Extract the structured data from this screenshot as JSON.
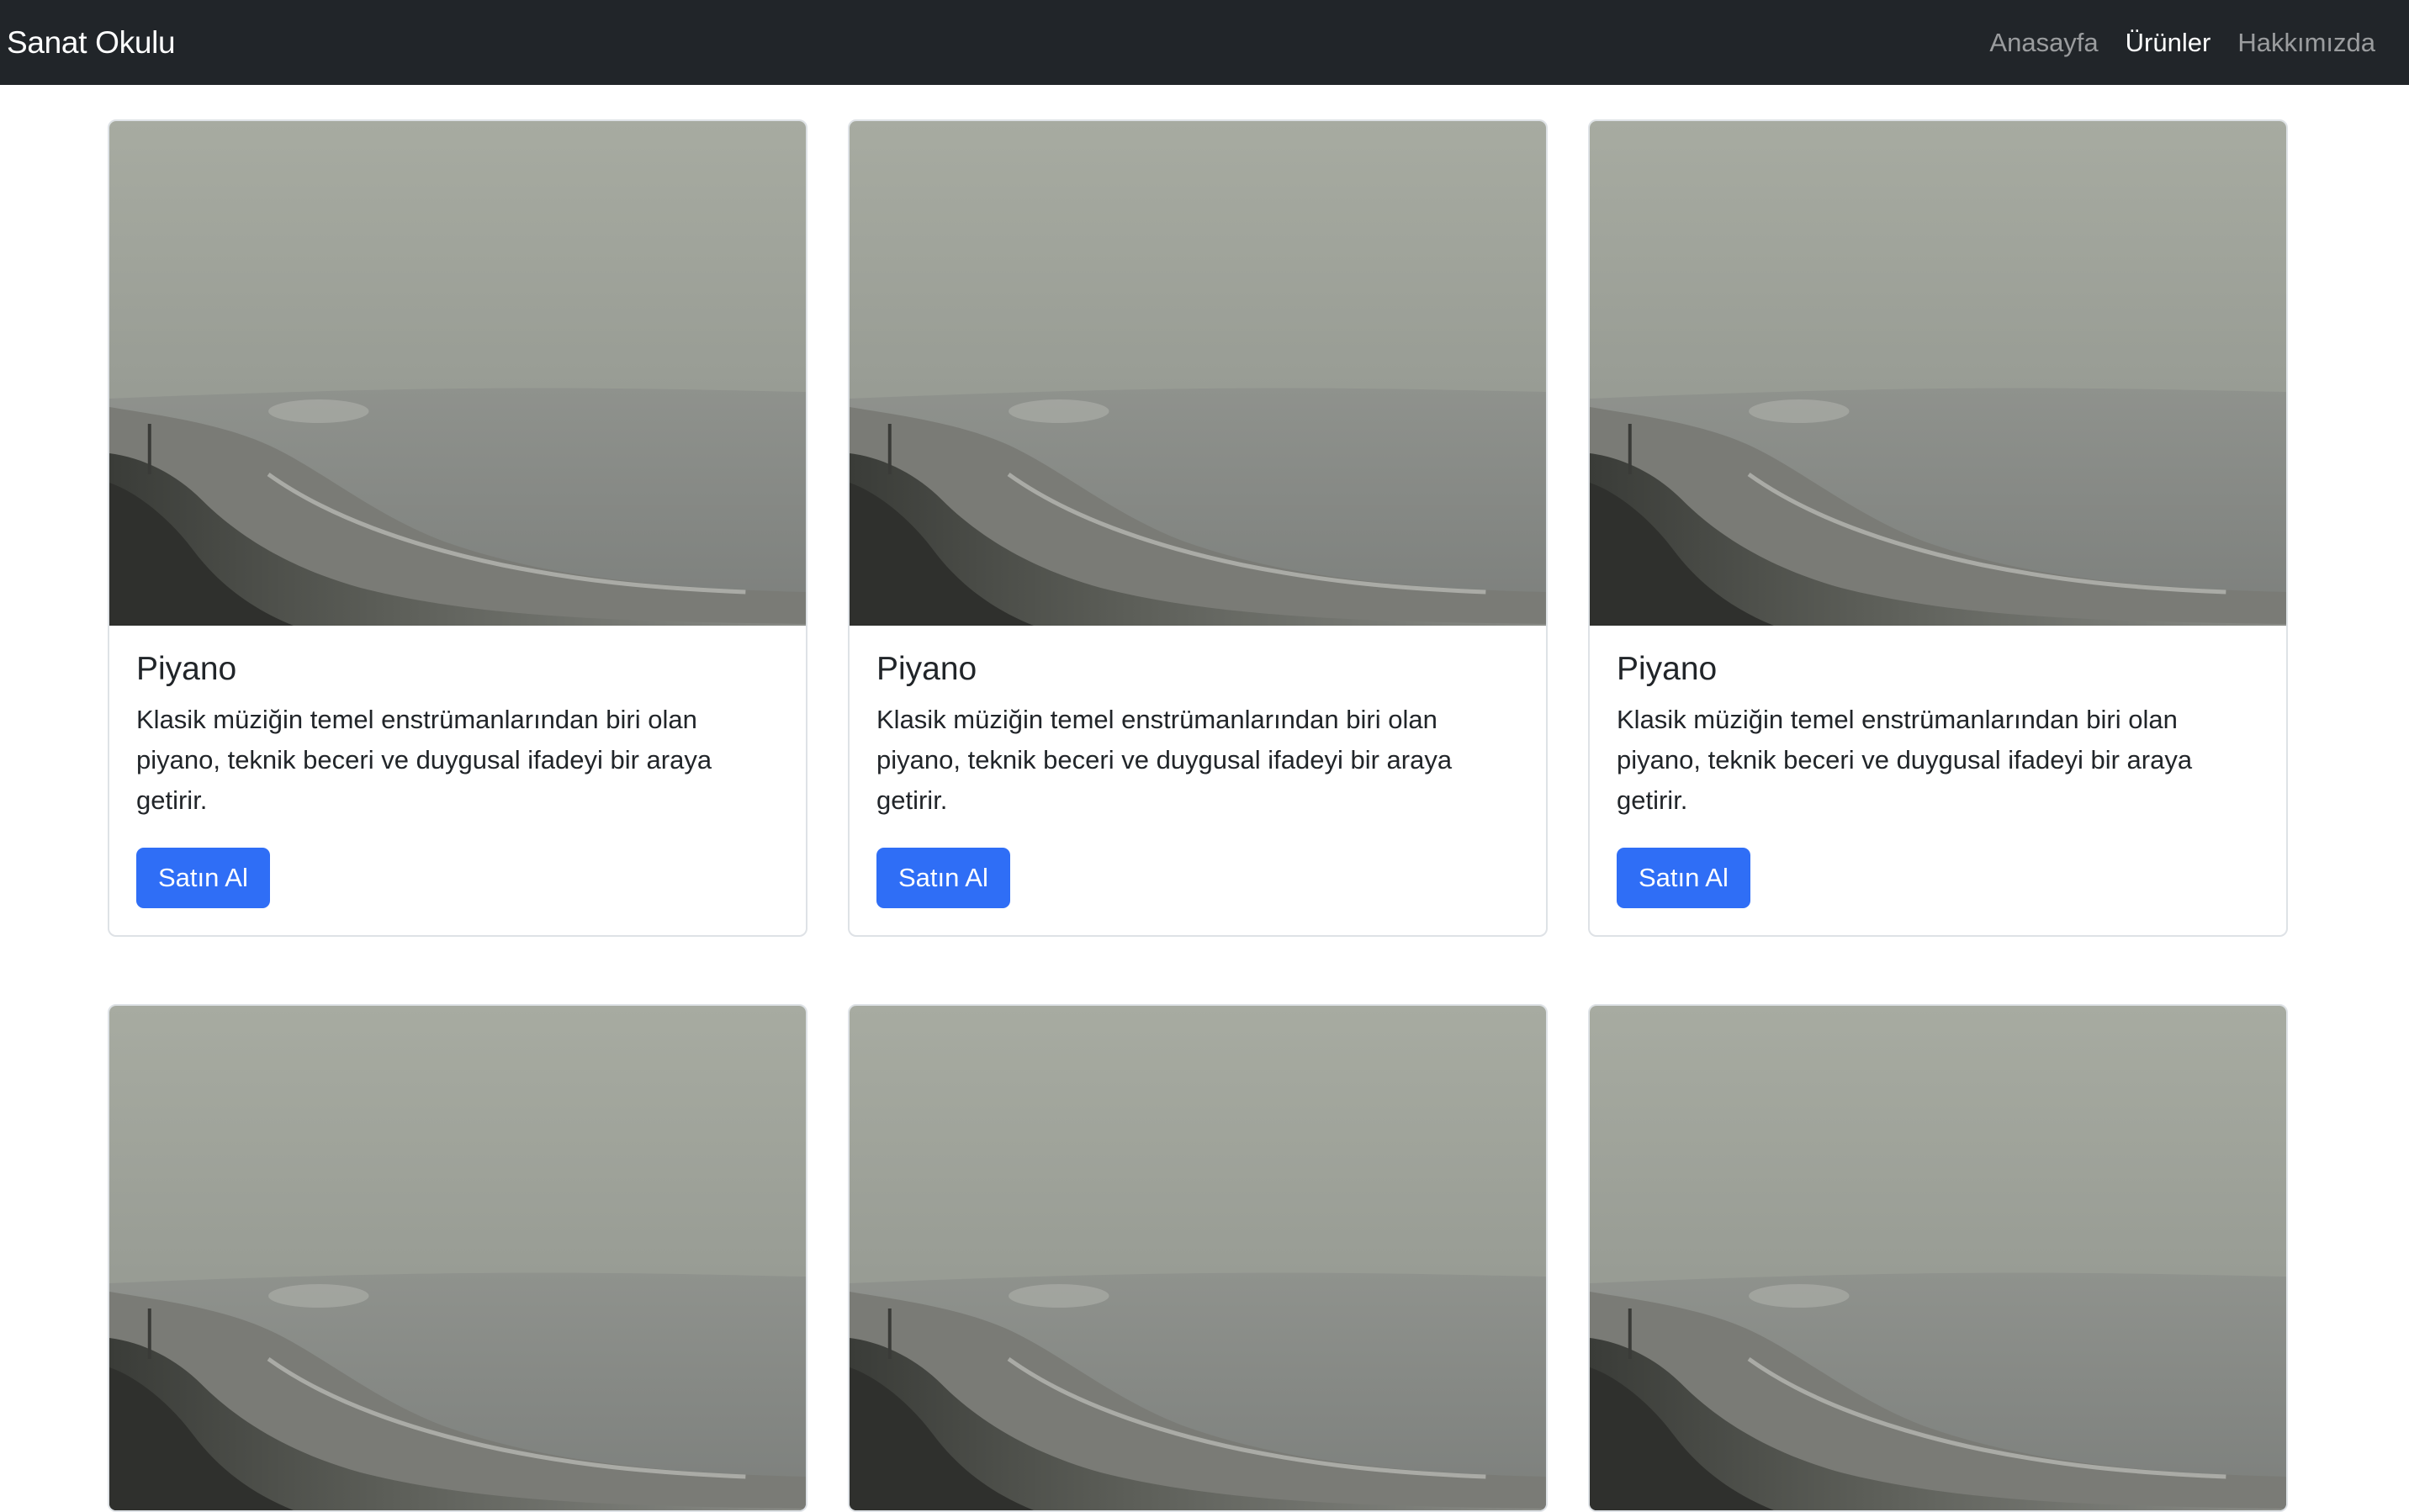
{
  "navbar": {
    "brand": "Sanat Okulu",
    "links": [
      {
        "label": "Anasayfa",
        "active": false
      },
      {
        "label": "Ürünler",
        "active": true
      },
      {
        "label": "Hakkımızda",
        "active": false
      }
    ],
    "background": "#212529"
  },
  "products": [
    {
      "title": "Piyano",
      "description": "Klasik müziğin temel enstrümanlarından biri olan piyano, teknik beceri ve duygusal ifadeyi bir araya getirir.",
      "button": "Satın Al"
    },
    {
      "title": "Piyano",
      "description": "Klasik müziğin temel enstrümanlarından biri olan piyano, teknik beceri ve duygusal ifadeyi bir araya getirir.",
      "button": "Satın Al"
    },
    {
      "title": "Piyano",
      "description": "Klasik müziğin temel enstrümanlarından biri olan piyano, teknik beceri ve duygusal ifadeyi bir araya getirir.",
      "button": "Satın Al"
    },
    {
      "title": "",
      "description": "",
      "button": ""
    },
    {
      "title": "",
      "description": "",
      "button": ""
    },
    {
      "title": "",
      "description": "",
      "button": ""
    }
  ],
  "colors": {
    "accent": "#2f6ef6",
    "card_border": "#dee2e6"
  }
}
